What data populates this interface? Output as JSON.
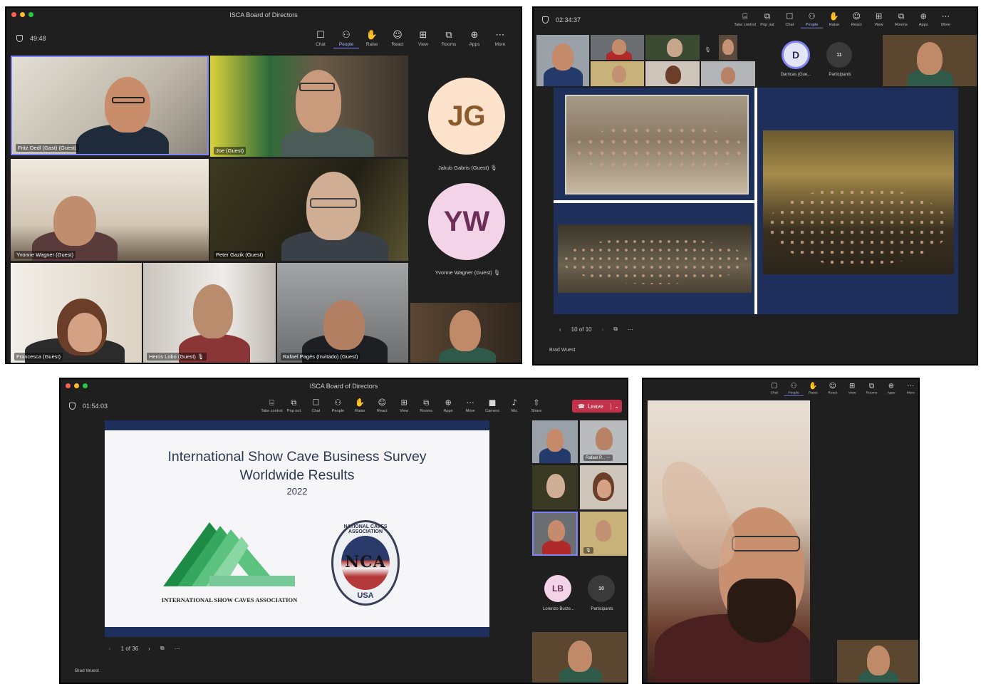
{
  "win1": {
    "title": "ISCA Board of Directors",
    "timer": "49:48",
    "toolbar": [
      {
        "icon": "chat-icon",
        "glyph": "☐",
        "label": "Chat"
      },
      {
        "icon": "people-icon",
        "glyph": "⚇",
        "label": "People"
      },
      {
        "icon": "raise-hand-icon",
        "glyph": "✋",
        "label": "Raise"
      },
      {
        "icon": "react-icon",
        "glyph": "☺",
        "label": "React"
      },
      {
        "icon": "view-icon",
        "glyph": "⊞",
        "label": "View"
      },
      {
        "icon": "rooms-icon",
        "glyph": "⧉",
        "label": "Rooms"
      },
      {
        "icon": "apps-icon",
        "glyph": "⊕",
        "label": "Apps"
      },
      {
        "icon": "more-icon",
        "glyph": "⋯",
        "label": "More"
      }
    ],
    "participants": [
      "Fritz Oedl (Gast) (Guest)",
      "Joe (Guest)",
      "Yvonne Wagner (Guest)",
      "Peter Gazik (Guest)",
      "Francesca (Guest)",
      "Heros Lobo (Guest)",
      "Rafael Pagés (Invitado) (Guest)"
    ],
    "avatars": [
      {
        "initials": "JG",
        "name": "Jakub Gabris (Guest)",
        "bg": "#fde3cc",
        "fg": "#8a5a2b"
      },
      {
        "initials": "YW",
        "name": "Yvonne Wagner (Guest)",
        "bg": "#f3d3e8",
        "fg": "#6b2f5a"
      }
    ]
  },
  "win2": {
    "timer": "02:34:37",
    "toolbar": [
      {
        "icon": "take-control-icon",
        "glyph": "⌸",
        "label": "Take control"
      },
      {
        "icon": "pop-out-icon",
        "glyph": "⧉",
        "label": "Pop out"
      },
      {
        "icon": "chat-icon",
        "glyph": "☐",
        "label": "Chat"
      },
      {
        "icon": "people-icon",
        "glyph": "⚇",
        "label": "People"
      },
      {
        "icon": "raise-hand-icon",
        "glyph": "✋",
        "label": "Raise"
      },
      {
        "icon": "react-icon",
        "glyph": "☺",
        "label": "React"
      },
      {
        "icon": "view-icon",
        "glyph": "⊞",
        "label": "View"
      },
      {
        "icon": "rooms-icon",
        "glyph": "⧉",
        "label": "Rooms"
      },
      {
        "icon": "apps-icon",
        "glyph": "⊕",
        "label": "Apps"
      },
      {
        "icon": "more-icon",
        "glyph": "⋯",
        "label": "More"
      }
    ],
    "avatar": {
      "initials": "D",
      "name": "Darricas (Gue..."
    },
    "participants_count": "11",
    "participants_label": "Participants",
    "page": "10 of 10",
    "presenter": "Brad Wuest"
  },
  "win3": {
    "title": "ISCA Board of Directors",
    "timer": "01:54:03",
    "toolbar": [
      {
        "icon": "take-control-icon",
        "glyph": "⌸",
        "label": "Take control"
      },
      {
        "icon": "pop-out-icon",
        "glyph": "⧉",
        "label": "Pop out"
      },
      {
        "icon": "chat-icon",
        "glyph": "☐",
        "label": "Chat"
      },
      {
        "icon": "people-icon",
        "glyph": "⚇",
        "label": "People"
      },
      {
        "icon": "raise-hand-icon",
        "glyph": "✋",
        "label": "Raise"
      },
      {
        "icon": "react-icon",
        "glyph": "☺",
        "label": "React"
      },
      {
        "icon": "view-icon",
        "glyph": "⊞",
        "label": "View"
      },
      {
        "icon": "rooms-icon",
        "glyph": "⧉",
        "label": "Rooms"
      },
      {
        "icon": "apps-icon",
        "glyph": "⊕",
        "label": "Apps"
      },
      {
        "icon": "more-icon",
        "glyph": "⋯",
        "label": "More"
      },
      {
        "icon": "camera-icon",
        "glyph": "■",
        "label": "Camera"
      },
      {
        "icon": "mic-icon",
        "glyph": "♪",
        "label": "Mic"
      },
      {
        "icon": "share-icon",
        "glyph": "⇧",
        "label": "Share"
      }
    ],
    "leave_label": "Leave",
    "slide": {
      "title_line1": "International Show Cave Business Survey",
      "title_line2": "Worldwide Results",
      "year": "2022",
      "isca_label": "INTERNATIONAL SHOW CAVES ASSOCIATION",
      "nca_text": "NATIONAL CAVES ASSOCIATION",
      "nca_letters": "NCA",
      "nca_usa": "USA"
    },
    "side_name": "Rafael P...",
    "avatar": {
      "initials": "LB",
      "name": "Lorenzo Burze..."
    },
    "participants_count": "10",
    "participants_label": "Participants",
    "page": "1 of 36",
    "presenter": "Brad Wuest"
  },
  "win4": {
    "toolbar": [
      {
        "icon": "chat-icon",
        "glyph": "☐",
        "label": "Chat"
      },
      {
        "icon": "people-icon",
        "glyph": "⚇",
        "label": "People"
      },
      {
        "icon": "raise-hand-icon",
        "glyph": "✋",
        "label": "Raise"
      },
      {
        "icon": "react-icon",
        "glyph": "☺",
        "label": "React"
      },
      {
        "icon": "view-icon",
        "glyph": "⊞",
        "label": "View"
      },
      {
        "icon": "rooms-icon",
        "glyph": "⧉",
        "label": "Rooms"
      },
      {
        "icon": "apps-icon",
        "glyph": "⊕",
        "label": "Apps"
      },
      {
        "icon": "more-icon",
        "glyph": "⋯",
        "label": "More"
      }
    ]
  },
  "colors": {
    "accent": "#7f85f5",
    "slide_blue": "#1f2f5c",
    "leave_red": "#c4314b",
    "isca_green": "#2e9e4f"
  }
}
